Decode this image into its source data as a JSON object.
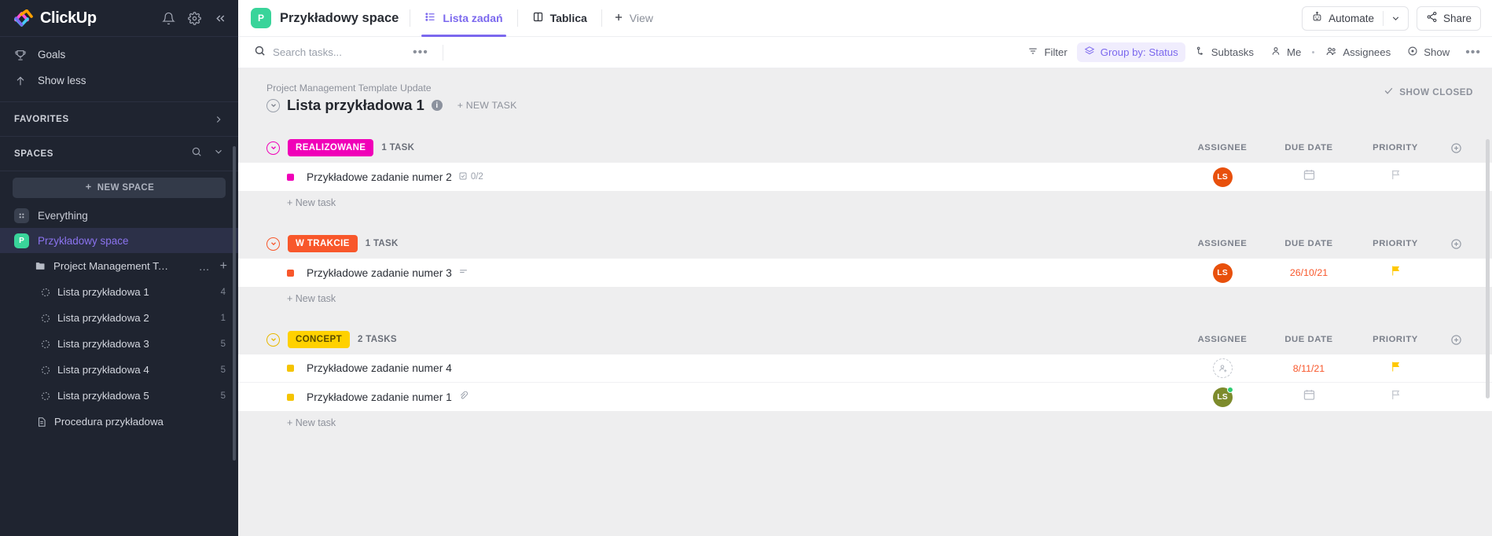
{
  "sidebar": {
    "brand": "ClickUp",
    "top_icons": [
      {
        "name": "notifications-icon",
        "glyph": "bell"
      },
      {
        "name": "settings-gear-icon",
        "glyph": "gear"
      },
      {
        "name": "collapse-sidebar-icon",
        "glyph": "chevrons-left"
      }
    ],
    "nav": [
      {
        "label": "Goals",
        "icon": "trophy-icon"
      },
      {
        "label": "Show less",
        "icon": "arrow-up-icon"
      }
    ],
    "favorites": {
      "label": "FAVORITES",
      "chevron": "chevron-right-icon"
    },
    "spaces": {
      "label": "SPACES",
      "search_icon": "search-icon",
      "chevron_icon": "chevron-down-icon",
      "new_space": "NEW SPACE"
    },
    "everything": {
      "label": "Everything",
      "icon": "grid-icon"
    },
    "space": {
      "label": "Przykładowy space",
      "initial": "P",
      "color": "#39d49a"
    },
    "folder": {
      "label": "Project Management Te...",
      "icon": "folder-icon",
      "more": "…",
      "add": "+"
    },
    "lists": [
      {
        "label": "Lista przykładowa 1",
        "count": "4"
      },
      {
        "label": "Lista przykładowa 2",
        "count": "1"
      },
      {
        "label": "Lista przykładowa 3",
        "count": "5"
      },
      {
        "label": "Lista przykładowa 4",
        "count": "5"
      },
      {
        "label": "Lista przykładowa 5",
        "count": "5"
      }
    ],
    "doc": {
      "label": "Procedura przykładowa",
      "icon": "doc-icon"
    }
  },
  "topbar": {
    "space_initial": "P",
    "space_name": "Przykładowy space",
    "tabs": [
      {
        "label": "Lista zadań",
        "icon": "list-icon",
        "active": true
      },
      {
        "label": "Tablica",
        "icon": "board-icon",
        "active": false
      }
    ],
    "add_view": "View",
    "automate": "Automate",
    "share": "Share"
  },
  "toolbar": {
    "search_placeholder": "Search tasks...",
    "search_value": "",
    "more": "•••",
    "items": [
      {
        "label": "Filter",
        "icon": "filter-icon",
        "highlighted": false
      },
      {
        "label": "Group by: Status",
        "icon": "layers-icon",
        "highlighted": true
      },
      {
        "label": "Subtasks",
        "icon": "subtask-icon",
        "highlighted": false
      },
      {
        "label": "Me",
        "icon": "person-icon",
        "highlighted": false
      },
      {
        "label": "Assignees",
        "icon": "people-icon",
        "highlighted": false
      },
      {
        "label": "Show",
        "icon": "eye-icon",
        "highlighted": false
      }
    ],
    "overflow": "•••"
  },
  "list_header": {
    "breadcrumb": "Project Management Template Update",
    "title": "Lista przykładowa 1",
    "info_icon": "info-icon",
    "new_task": "+ NEW TASK",
    "show_closed": "SHOW CLOSED",
    "show_closed_icon": "check-icon"
  },
  "columns": {
    "assignee": "ASSIGNEE",
    "due_date": "DUE DATE",
    "priority": "PRIORITY",
    "add": "add-column-icon"
  },
  "groups": [
    {
      "status": "REALIZOWANE",
      "color": "#f000b8",
      "count": "1 TASK",
      "new_task": "+ New task",
      "tasks": [
        {
          "name": "Przykładowe zadanie numer 2",
          "dot_color": "#f000b8",
          "meta": "0/2",
          "meta_icon": "checklist-icon",
          "assignee": {
            "initials": "LS",
            "color": "#e8500c",
            "empty": false,
            "online": false
          },
          "due_date": "",
          "due_icon": "calendar-icon",
          "due_color": "#b9bdc6",
          "priority_flag_color": "#c5c9d0"
        }
      ]
    },
    {
      "status": "W TRAKCIE",
      "color": "#f8572b",
      "count": "1 TASK",
      "new_task": "+ New task",
      "tasks": [
        {
          "name": "Przykładowe zadanie numer 3",
          "dot_color": "#f8572b",
          "meta": "",
          "meta_icon": "description-icon",
          "assignee": {
            "initials": "LS",
            "color": "#e8500c",
            "empty": false,
            "online": false
          },
          "due_date": "26/10/21",
          "due_icon": "",
          "due_color": "#f8572b",
          "priority_flag_color": "#ffc800"
        }
      ]
    },
    {
      "status": "CONCEPT",
      "color": "#ffd100",
      "text_color": "#5b4b00",
      "count": "2 TASKS",
      "new_task": "+ New task",
      "tasks": [
        {
          "name": "Przykładowe zadanie numer 4",
          "dot_color": "#f5c400",
          "meta": "",
          "meta_icon": "",
          "assignee": {
            "initials": "",
            "color": "",
            "empty": true,
            "online": false
          },
          "due_date": "8/11/21",
          "due_icon": "",
          "due_color": "#f8572b",
          "priority_flag_color": "#ffc800"
        },
        {
          "name": "Przykładowe zadanie numer 1",
          "dot_color": "#f5c400",
          "meta": "",
          "meta_icon": "attachment-icon",
          "assignee": {
            "initials": "LS",
            "color": "#7d8b2c",
            "empty": false,
            "online": true
          },
          "due_date": "",
          "due_icon": "calendar-icon",
          "due_color": "#b9bdc6",
          "priority_flag_color": "#c5c9d0"
        }
      ]
    }
  ]
}
